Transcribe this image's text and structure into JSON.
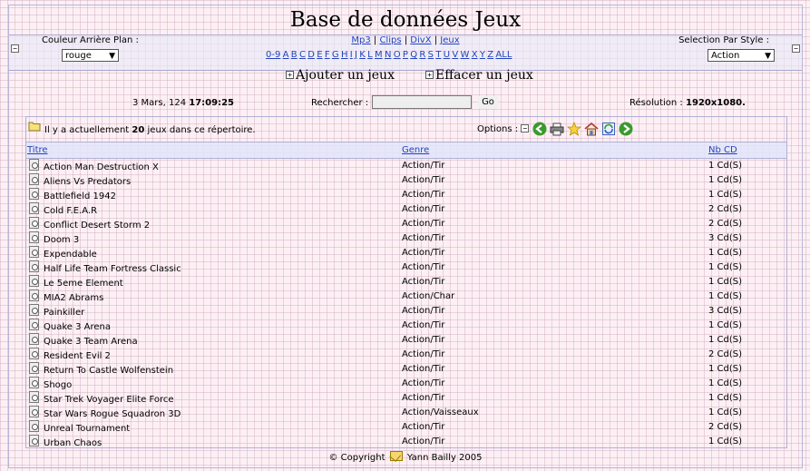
{
  "title": "Base de données Jeux",
  "header": {
    "bg_label": "Couleur Arrière Plan :",
    "bg_value": "rouge",
    "style_label": "Selection Par Style :",
    "style_value": "Action",
    "nav": [
      "Mp3",
      "Clips",
      "DivX",
      "Jeux"
    ],
    "nav_sep": "|",
    "letters": [
      "0-9",
      "A",
      "B",
      "C",
      "D",
      "E",
      "F",
      "G",
      "H",
      "I",
      "J",
      "K",
      "L",
      "M",
      "N",
      "O",
      "P",
      "Q",
      "R",
      "S",
      "T",
      "U",
      "V",
      "W",
      "X",
      "Y",
      "Z",
      "ALL"
    ]
  },
  "actions": {
    "add": "Ajouter un jeux",
    "remove": "Effacer un jeux"
  },
  "status": {
    "date": "3 Mars, 124",
    "time": "17:09:25",
    "search_label": "Rechercher :",
    "search_value": "",
    "go": "Go",
    "resolution_label": "Résolution :",
    "resolution_value": "1920x1080."
  },
  "info": {
    "prefix": "Il y a actuellement",
    "count": "20",
    "suffix": "jeux dans ce répertoire.",
    "options": "Options :"
  },
  "columns": {
    "title": "Titre",
    "genre": "Genre",
    "cd": "Nb CD"
  },
  "games": [
    {
      "title": "Action Man Destruction X",
      "genre": "Action/Tir",
      "cd": "1 Cd(S)"
    },
    {
      "title": "Aliens Vs Predators",
      "genre": "Action/Tir",
      "cd": "1 Cd(S)"
    },
    {
      "title": "Battlefield 1942",
      "genre": "Action/Tir",
      "cd": "1 Cd(S)"
    },
    {
      "title": "Cold F.E.A.R",
      "genre": "Action/Tir",
      "cd": "2 Cd(S)"
    },
    {
      "title": "Conflict Desert Storm 2",
      "genre": "Action/Tir",
      "cd": "2 Cd(S)"
    },
    {
      "title": "Doom 3",
      "genre": "Action/Tir",
      "cd": "3 Cd(S)"
    },
    {
      "title": "Expendable",
      "genre": "Action/Tir",
      "cd": "1 Cd(S)"
    },
    {
      "title": "Half Life Team Fortress Classic",
      "genre": "Action/Tir",
      "cd": "1 Cd(S)"
    },
    {
      "title": "Le 5eme Element",
      "genre": "Action/Tir",
      "cd": "1 Cd(S)"
    },
    {
      "title": "MIA2 Abrams",
      "genre": "Action/Char",
      "cd": "1 Cd(S)"
    },
    {
      "title": "Painkiller",
      "genre": "Action/Tir",
      "cd": "3 Cd(S)"
    },
    {
      "title": "Quake 3 Arena",
      "genre": "Action/Tir",
      "cd": "1 Cd(S)"
    },
    {
      "title": "Quake 3 Team Arena",
      "genre": "Action/Tir",
      "cd": "1 Cd(S)"
    },
    {
      "title": "Resident Evil 2",
      "genre": "Action/Tir",
      "cd": "2 Cd(S)"
    },
    {
      "title": "Return To Castle Wolfenstein",
      "genre": "Action/Tir",
      "cd": "1 Cd(S)"
    },
    {
      "title": "Shogo",
      "genre": "Action/Tir",
      "cd": "1 Cd(S)"
    },
    {
      "title": "Star Trek Voyager Elite Force",
      "genre": "Action/Tir",
      "cd": "1 Cd(S)"
    },
    {
      "title": "Star Wars Rogue Squadron 3D",
      "genre": "Action/Vaisseaux",
      "cd": "1 Cd(S)"
    },
    {
      "title": "Unreal Tournament",
      "genre": "Action/Tir",
      "cd": "2 Cd(S)"
    },
    {
      "title": "Urban Chaos",
      "genre": "Action/Tir",
      "cd": "1 Cd(S)"
    }
  ],
  "footer": {
    "prefix": "© Copyright",
    "author": "Yann Bailly 2005"
  },
  "icons": [
    "minus-icon",
    "plus-icon",
    "folder-icon",
    "back-arrow-icon",
    "printer-icon",
    "favorite-star-icon",
    "home-icon",
    "refresh-icon",
    "forward-arrow-icon",
    "cd-icon",
    "mail-icon"
  ],
  "colors": {
    "link": "#2244bb",
    "background": "#fdf0f4",
    "header_band": "#e2e5fa"
  }
}
